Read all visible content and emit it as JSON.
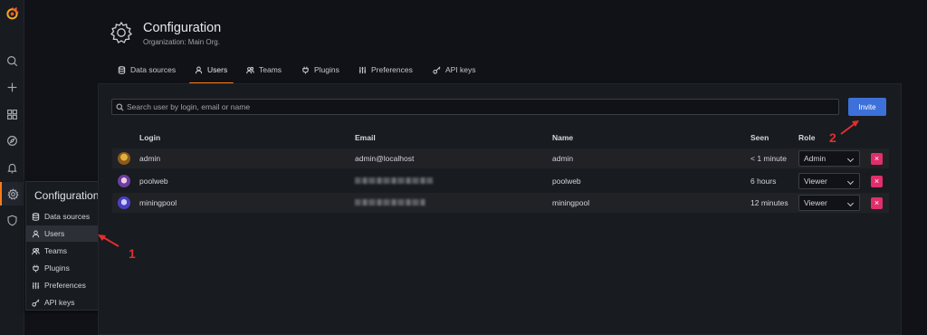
{
  "sidenav": {
    "items": [
      "grafana-logo-icon",
      "search-icon",
      "plus-icon",
      "dashboards-icon",
      "explore-icon",
      "alerting-icon",
      "configuration-icon",
      "shield-icon"
    ]
  },
  "flyout": {
    "title": "Configuration",
    "items": [
      {
        "label": "Data sources",
        "icon": "database-icon"
      },
      {
        "label": "Users",
        "icon": "user-icon"
      },
      {
        "label": "Teams",
        "icon": "users-icon"
      },
      {
        "label": "Plugins",
        "icon": "plug-icon"
      },
      {
        "label": "Preferences",
        "icon": "sliders-icon"
      },
      {
        "label": "API keys",
        "icon": "key-icon"
      }
    ]
  },
  "header": {
    "title": "Configuration",
    "subtitle": "Organization: Main Org."
  },
  "tabs": [
    {
      "label": "Data sources",
      "icon": "database-icon"
    },
    {
      "label": "Users",
      "icon": "user-icon",
      "active": true
    },
    {
      "label": "Teams",
      "icon": "users-icon"
    },
    {
      "label": "Plugins",
      "icon": "plug-icon"
    },
    {
      "label": "Preferences",
      "icon": "sliders-icon"
    },
    {
      "label": "API keys",
      "icon": "key-icon"
    }
  ],
  "search": {
    "placeholder": "Search user by login, email or name"
  },
  "invite_label": "Invite",
  "table": {
    "columns": {
      "login": "Login",
      "email": "Email",
      "name": "Name",
      "seen": "Seen",
      "role": "Role"
    },
    "rows": [
      {
        "login": "admin",
        "email": "admin@localhost",
        "name": "admin",
        "seen": "< 1 minute",
        "role": "Admin",
        "email_hidden": false
      },
      {
        "login": "poolweb",
        "email": "",
        "name": "poolweb",
        "seen": "6 hours",
        "role": "Viewer",
        "email_hidden": true
      },
      {
        "login": "miningpool",
        "email": "",
        "name": "miningpool",
        "seen": "12 minutes",
        "role": "Viewer",
        "email_hidden": true
      }
    ],
    "delete_label": "×"
  },
  "annotations": {
    "one": "1",
    "two": "2"
  },
  "colors": {
    "accent": "#ff7a1a",
    "primary": "#3d71d9",
    "danger": "#e02f6b",
    "annotation": "#e02f2f"
  }
}
